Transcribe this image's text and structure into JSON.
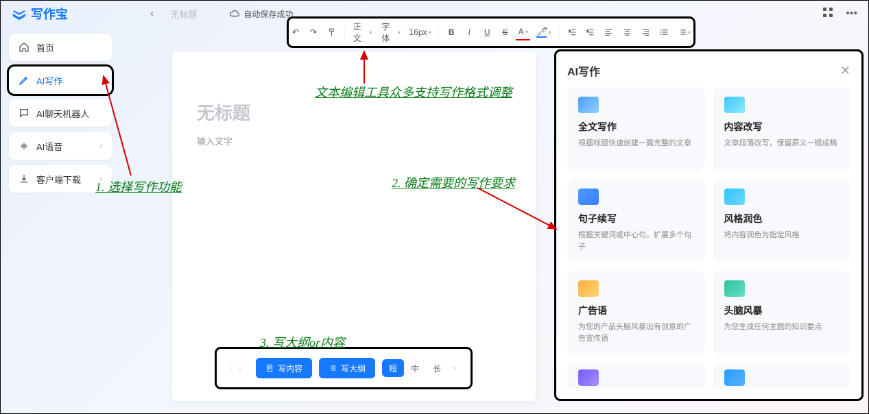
{
  "app": {
    "name": "写作宝"
  },
  "top": {
    "doc_title": "无标题",
    "autosave": "自动保存成功"
  },
  "sidebar": {
    "items": [
      {
        "label": "首页"
      },
      {
        "label": "AI写作"
      },
      {
        "label": "AI聊天机器人"
      },
      {
        "label": "AI语音"
      },
      {
        "label": "客户端下载"
      }
    ]
  },
  "toolbar": {
    "paragraph": "正文",
    "font": "字体",
    "size": "16px",
    "bold": "B",
    "italic": "I",
    "underline": "U",
    "strike": "S",
    "textcolor": "A",
    "highlight": "A"
  },
  "editor": {
    "title_placeholder": "无标题",
    "body_placeholder": "输入文字"
  },
  "action_bar": {
    "write_content": "写内容",
    "write_outline": "写大纲",
    "len_short": "短",
    "len_mid": "中",
    "len_long": "长"
  },
  "ai_panel": {
    "title": "AI写作",
    "cards": [
      {
        "title": "全文写作",
        "desc": "根据标题快速创建一篇完整的文章"
      },
      {
        "title": "内容改写",
        "desc": "文章段落改写，保留原义一键成稿"
      },
      {
        "title": "句子续写",
        "desc": "根据关键词或中心句，扩展多个句子"
      },
      {
        "title": "风格润色",
        "desc": "将内容润色为指定风格"
      },
      {
        "title": "广告语",
        "desc": "为您的产品头脑风暴出有创意的广告宣传语"
      },
      {
        "title": "头脑风暴",
        "desc": "为您生成任何主题的知识要点"
      }
    ]
  },
  "annotations": {
    "a1": "1. 选择写作功能",
    "a2": "2. 确定需要的写作要求",
    "a3": "3. 写大纲or内容",
    "toolbar_note": "文本编辑工具众多支持写作格式调整"
  }
}
